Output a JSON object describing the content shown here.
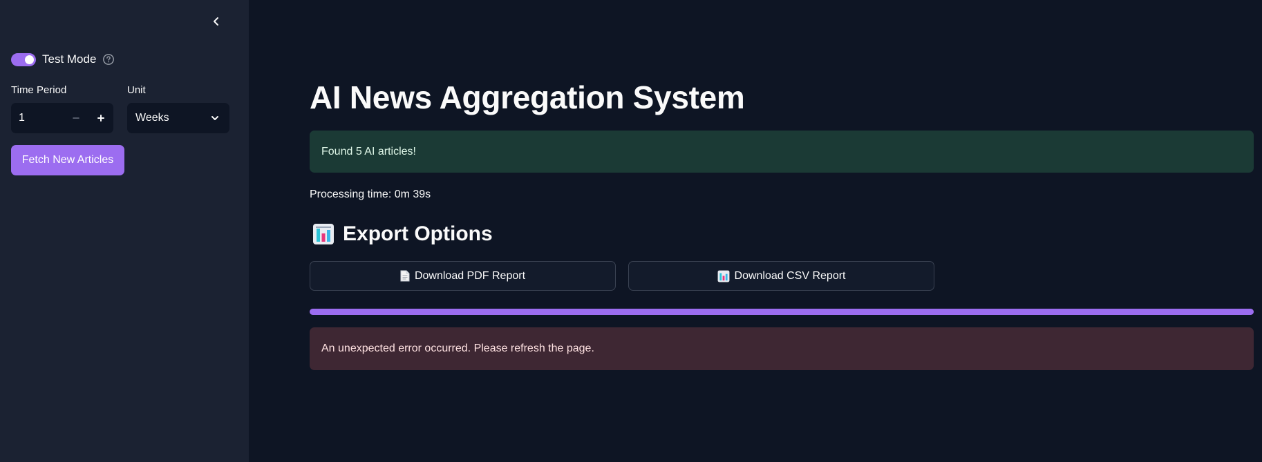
{
  "sidebar": {
    "collapse_icon": "chevron-left-icon",
    "test_mode": {
      "label": "Test Mode",
      "enabled": true,
      "help_icon": "question-circle-icon"
    },
    "time_period": {
      "label": "Time Period",
      "value": "1",
      "decrement_icon": "minus-icon",
      "increment_icon": "plus-icon"
    },
    "unit": {
      "label": "Unit",
      "selected": "Weeks",
      "dropdown_icon": "chevron-down-icon"
    },
    "fetch_button": {
      "label": "Fetch New Articles"
    }
  },
  "main": {
    "title": "AI News Aggregation System",
    "success_message": "Found 5 AI articles!",
    "processing_time": "Processing time: 0m 39s",
    "export": {
      "heading": "Export Options",
      "heading_icon": "bar-chart-icon",
      "pdf_button": {
        "label": "Download PDF Report",
        "icon": "document-icon"
      },
      "csv_button": {
        "label": "Download CSV Report",
        "icon": "bar-chart-icon"
      }
    },
    "progress": 1.0,
    "error_message": "An unexpected error occurred. Please refresh the page."
  },
  "colors": {
    "accent": "#9c6df0",
    "sidebar_bg": "#1b2232",
    "main_bg": "#0e1524",
    "success_bg": "#1b3a35",
    "error_bg": "#3e2733"
  }
}
